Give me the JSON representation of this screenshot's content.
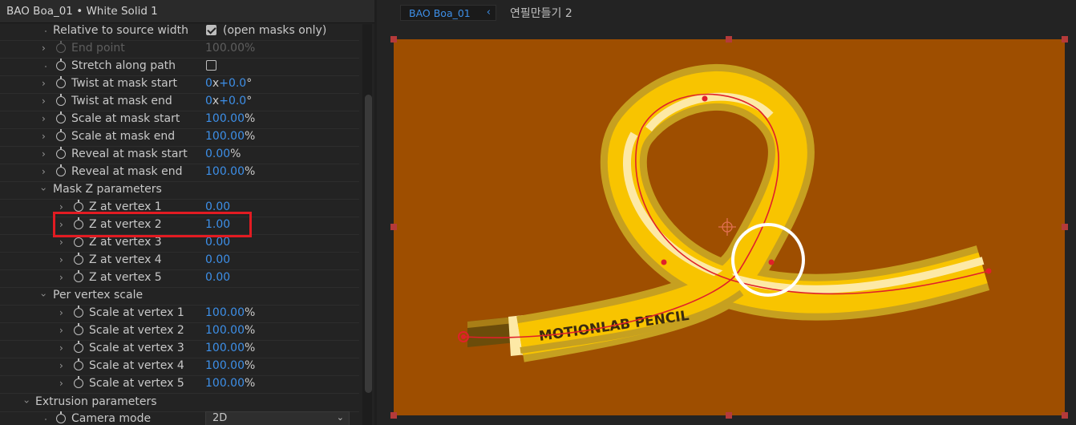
{
  "left_panel": {
    "title": "BAO Boa_01 • White Solid 1",
    "rows": [
      {
        "label": "Relative to source width",
        "checkbox": true,
        "checked": true,
        "checkbox_text": "(open masks only)"
      },
      {
        "label": "End point",
        "value": "100.00%",
        "dim": true
      },
      {
        "label": "Stretch along path",
        "checkbox": true,
        "checked": false
      },
      {
        "label": "Twist at mask start",
        "value_num": "0",
        "value_mid": "x",
        "value_num2": "+0.0",
        "value_unit": "°"
      },
      {
        "label": "Twist at mask end",
        "value_num": "0",
        "value_mid": "x",
        "value_num2": "+0.0",
        "value_unit": "°"
      },
      {
        "label": "Scale at mask start",
        "value_num": "100.00",
        "value_unit": "%"
      },
      {
        "label": "Scale at mask end",
        "value_num": "100.00",
        "value_unit": "%"
      },
      {
        "label": "Reveal at mask start",
        "value_num": "0.00",
        "value_unit": "%"
      },
      {
        "label": "Reveal at mask end",
        "value_num": "100.00",
        "value_unit": "%"
      },
      {
        "label": "Mask Z parameters",
        "group": true
      },
      {
        "label": "Z at vertex 1",
        "value_num": "0.00"
      },
      {
        "label": "Z at vertex 2",
        "value_num": "1.00"
      },
      {
        "label": "Z at vertex 3",
        "value_num": "0.00"
      },
      {
        "label": "Z at vertex 4",
        "value_num": "0.00"
      },
      {
        "label": "Z at vertex 5",
        "value_num": "0.00"
      },
      {
        "label": "Per vertex scale",
        "group": true
      },
      {
        "label": "Scale at vertex 1",
        "value_num": "100.00",
        "value_unit": "%"
      },
      {
        "label": "Scale at vertex 2",
        "value_num": "100.00",
        "value_unit": "%"
      },
      {
        "label": "Scale at vertex 3",
        "value_num": "100.00",
        "value_unit": "%"
      },
      {
        "label": "Scale at vertex 4",
        "value_num": "100.00",
        "value_unit": "%"
      },
      {
        "label": "Scale at vertex 5",
        "value_num": "100.00",
        "value_unit": "%"
      },
      {
        "label": "Extrusion parameters",
        "group": true
      },
      {
        "label": "Camera mode",
        "dropdown": "2D"
      }
    ]
  },
  "viewer": {
    "tabs": [
      {
        "label": "BAO Boa_01",
        "active": true
      },
      {
        "label": "연필만들기 2",
        "active": false
      }
    ],
    "pencil_text": "MOTIONLAB PENCIL",
    "colors": {
      "background": "#9e4e00",
      "pencil_outer": "#c6a020",
      "pencil_body": "#f8c400",
      "pencil_highlight": "#fde9a6",
      "mask_path": "#e0202a",
      "highlight_box": "#e21b22"
    }
  }
}
